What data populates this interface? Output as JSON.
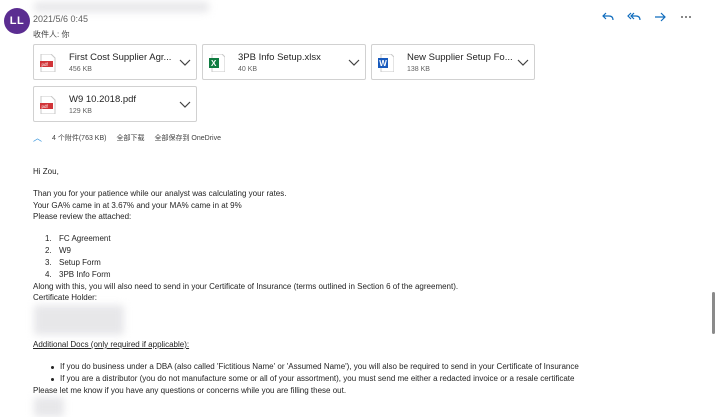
{
  "sender": {
    "avatar_initials": "LL",
    "datetime": "2021/5/6 0:45",
    "recipient_label": "收件人:",
    "recipient": "你"
  },
  "actions": [
    {
      "name": "reply",
      "icon": "reply-icon"
    },
    {
      "name": "reply-all",
      "icon": "reply-all-icon"
    },
    {
      "name": "forward",
      "icon": "forward-icon"
    },
    {
      "name": "more",
      "icon": "more-icon"
    }
  ],
  "attachments": [
    {
      "name": "First Cost Supplier Agr...",
      "size": "456 KB",
      "type": "pdf"
    },
    {
      "name": "3PB Info Setup.xlsx",
      "size": "40 KB",
      "type": "xlsx"
    },
    {
      "name": "New Supplier Setup Fo...",
      "size": "138 KB",
      "type": "docx"
    },
    {
      "name": "W9 10.2018.pdf",
      "size": "129 KB",
      "type": "pdf"
    }
  ],
  "attachment_summary": {
    "count_label": "4 个附件(763 KB)",
    "download_all": "全部下载",
    "save_all": "全部保存到 OneDrive"
  },
  "email": {
    "greeting": "Hi Zou,",
    "line1": "Than you for your patience while our analyst was calculating your rates.",
    "line2": "Your GA% came in at 3.67% and your MA% came in at 9%",
    "line3": "Please review the attached:",
    "list": [
      "FC Agreement",
      "W9",
      "Setup Form",
      "3PB Info Form"
    ],
    "line4": "Along with this, you will also need to send in your Certificate of Insurance (terms outlined in Section 6 of the agreement).",
    "cert_holder": "Certificate Holder:",
    "additional_docs": "Additional Docs (only required if applicable):",
    "bullets": [
      "If you do business under a DBA (also called 'Fictitious Name' or 'Assumed Name'), you will also be required to send in your Certificate of Insurance",
      "If you are a distributor (you do not manufacture some or all of your assortment), you must send me either a redacted invoice or a resale certificate"
    ],
    "closing": "Please let me know if you have any questions or concerns while you are filling these out."
  },
  "colors": {
    "avatar": "#5b2d91",
    "accent": "#0f6cbd",
    "pdf": "#d13438",
    "xlsx": "#107c41",
    "docx": "#185abd"
  }
}
